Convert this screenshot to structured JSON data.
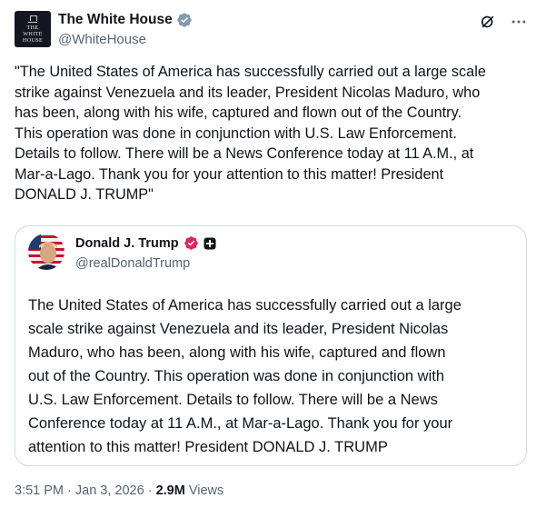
{
  "author": {
    "display_name": "The White House",
    "handle": "@WhiteHouse",
    "avatar_text": [
      "THE",
      "WHITE",
      "HOUSE"
    ],
    "badge_icon": "gray-verified-badge-icon",
    "badge_color": "#829aab"
  },
  "actions": {
    "grok_icon": "grok-icon",
    "more_icon": "more-options-icon"
  },
  "post": {
    "text": "\"The United States of America has successfully carried out a large scale\nstrike against Venezuela and its leader, President Nicolas Maduro, who\nhas been, along with his wife, captured and flown out of the Country.\nThis operation was done in conjunction with U.S. Law Enforcement.\nDetails to follow. There will be a News Conference today at 11 A.M., at\nMar-a-Lago. Thank you for your attention to this matter! President\nDONALD J. TRUMP\""
  },
  "quoted_post": {
    "display_name": "Donald J. Trump",
    "handle": "@realDonaldTrump",
    "badge_icon": "verified-badge-icon",
    "badge_color": "#e0245e",
    "affiliation_icon": "affiliate-plus-icon",
    "text": "The United States of America has successfully carried out a large\nscale strike against Venezuela and its leader, President Nicolas\nMaduro, who has been, along with his wife, captured and flown\nout of the Country. This operation was done in conjunction with\nU.S. Law Enforcement. Details to follow. There will be a News\nConference today at 11 A.M., at Mar-a-Lago. Thank you for your\nattention to this matter! President DONALD J. TRUMP"
  },
  "meta": {
    "time": "3:51 PM",
    "separator": " · ",
    "date": "Jan 3, 2026",
    "views_count": "2.9M",
    "views_label": " Views"
  }
}
